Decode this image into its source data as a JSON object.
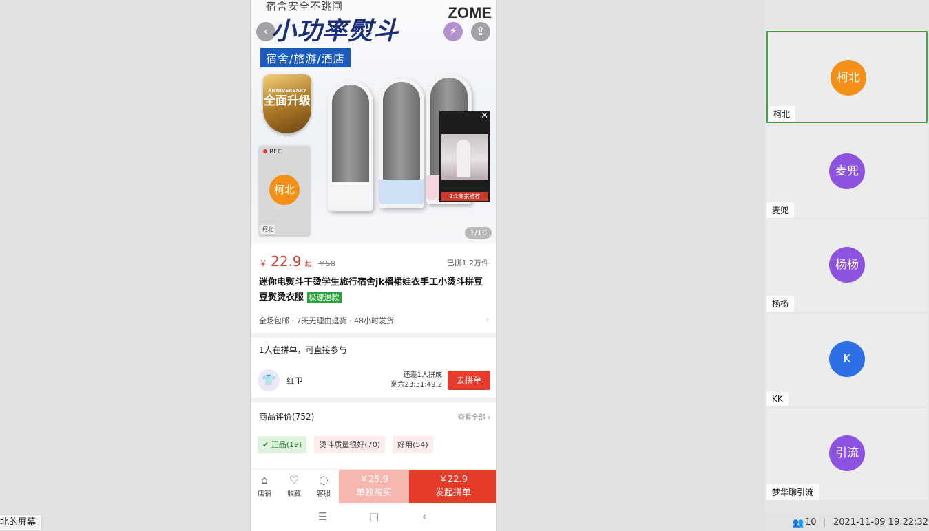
{
  "share_label": "北的屏幕",
  "phone": {
    "hero": {
      "statusbar": "宿舍安全不跳闸",
      "title": "小功率熨斗",
      "brand": "ZOME",
      "subtitle": "宿舍/旅游/酒店",
      "badge_small": "ANNIVERSARY",
      "badge_text": "全面升级",
      "pager": "1/10",
      "rec_label": "REC",
      "rec_avatar": "柯北",
      "rec_name": "柯北",
      "video_caption": "1:1商家推荐"
    },
    "price": {
      "currency": "￥",
      "value": "22.9",
      "qi": "起",
      "original": "￥58",
      "sold": "已拼1.2万件"
    },
    "title": "迷你电熨斗干烫学生旅行宿舍jk褶裙娃衣手工小烫斗拼豆豆熨烫衣服",
    "title_tag": "极速退款",
    "service": "全场包邮 · 7天无理由退货 · 48小时发货",
    "group": {
      "heading": "1人在拼单，可直接参与",
      "user": "红卫",
      "lack_line1": "还差1人拼成",
      "lack_line2": "剩余23:31:49.2",
      "go_label": "去拼单"
    },
    "reviews": {
      "heading": "商品评价(752)",
      "view_all": "查看全部",
      "chips": [
        {
          "label": "正品(19)"
        },
        {
          "label": "烫斗质量很好(70)"
        },
        {
          "label": "好用(54)"
        }
      ]
    },
    "cart": {
      "store": "店铺",
      "favorite": "收藏",
      "service": "客服",
      "solo_price": "￥25.9",
      "solo_label": "单独购买",
      "group_price": "￥22.9",
      "group_label": "发起拼单"
    }
  },
  "participants": [
    {
      "name": "柯北",
      "initial": "柯北",
      "color": "#f39017",
      "active": true
    },
    {
      "name": "麦兜",
      "initial": "麦兜",
      "color": "#8e52e0",
      "active": false
    },
    {
      "name": "杨杨",
      "initial": "杨杨",
      "color": "#8e52e0",
      "active": false
    },
    {
      "name": "KK",
      "initial": "K",
      "color": "#2e6fe6",
      "active": false
    },
    {
      "name": "梦华聊引流",
      "initial": "引流",
      "color": "#8e52e0",
      "active": false
    }
  ],
  "status": {
    "participant_count": "10",
    "datetime": "2021-11-09 19:22:32"
  },
  "colors": {
    "accent_red": "#e63b28",
    "active_border": "#3da64a"
  }
}
